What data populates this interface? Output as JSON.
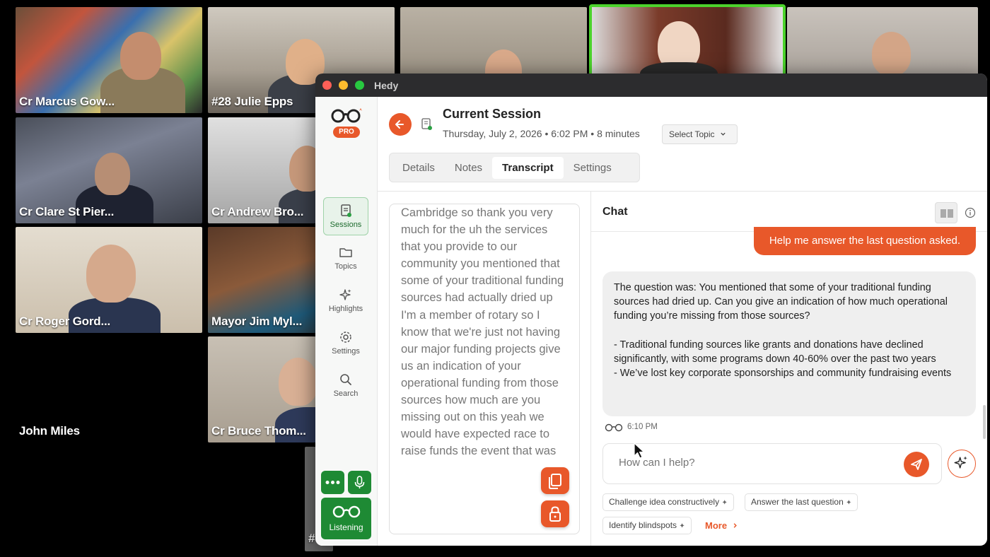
{
  "meeting": {
    "participants": [
      {
        "name": "Cr Marcus Gow..."
      },
      {
        "name": "#28 Julie Epps"
      },
      {
        "name": "Cr Clare St Pier..."
      },
      {
        "name": "Cr Andrew Bro..."
      },
      {
        "name": "Cr Roger Gord..."
      },
      {
        "name": "Mayor Jim Myl..."
      },
      {
        "name": "John Miles"
      },
      {
        "name": "Cr Bruce Thom..."
      },
      {
        "name": "#"
      }
    ]
  },
  "window": {
    "title": "Hedy"
  },
  "sidebar": {
    "badge": "PRO",
    "items": [
      {
        "label": "Sessions",
        "icon": "sessions-icon"
      },
      {
        "label": "Topics",
        "icon": "folder-icon"
      },
      {
        "label": "Highlights",
        "icon": "sparkle-icon"
      },
      {
        "label": "Settings",
        "icon": "gear-icon"
      },
      {
        "label": "Search",
        "icon": "search-icon"
      }
    ],
    "listening_label": "Listening"
  },
  "session": {
    "title": "Current Session",
    "meta": "Thursday, July 2, 2026 • 6:02 PM  •  8 minutes",
    "select_topic": "Select Topic",
    "tabs": [
      "Details",
      "Notes",
      "Transcript",
      "Settings"
    ],
    "active_tab": "Transcript"
  },
  "transcript": {
    "text": "Cambridge so thank you very much for the uh the services that you provide to our community you mentioned that some of your traditional funding sources had actually dried up I'm a member of rotary so I know that we're just not having our major funding projects give us an indication of your operational funding from those sources how much are you missing out on this yeah we would have expected race to raise funds the event that was"
  },
  "chat": {
    "title": "Chat",
    "user_message": "Help me answer the last question asked.",
    "ai_message": {
      "intro": "The question was: You mentioned that some of your traditional funding sources had dried up. Can you give an indication of how much operational funding you’re missing from those sources?",
      "bullet1": "- Traditional funding sources like grants and donations have declined significantly, with some programs down 40-60% over the past two years",
      "bullet2": "- We’ve lost key corporate sponsorships and community fundraising events"
    },
    "time": "6:10 PM",
    "input_placeholder": "How can I help?",
    "suggestions": [
      "Challenge idea constructively",
      "Answer the last question",
      "Identify blindspots"
    ],
    "more_label": "More"
  },
  "colors": {
    "accent": "#e8582a",
    "brand_green": "#1e8a34",
    "speaking": "#4cd32c"
  }
}
